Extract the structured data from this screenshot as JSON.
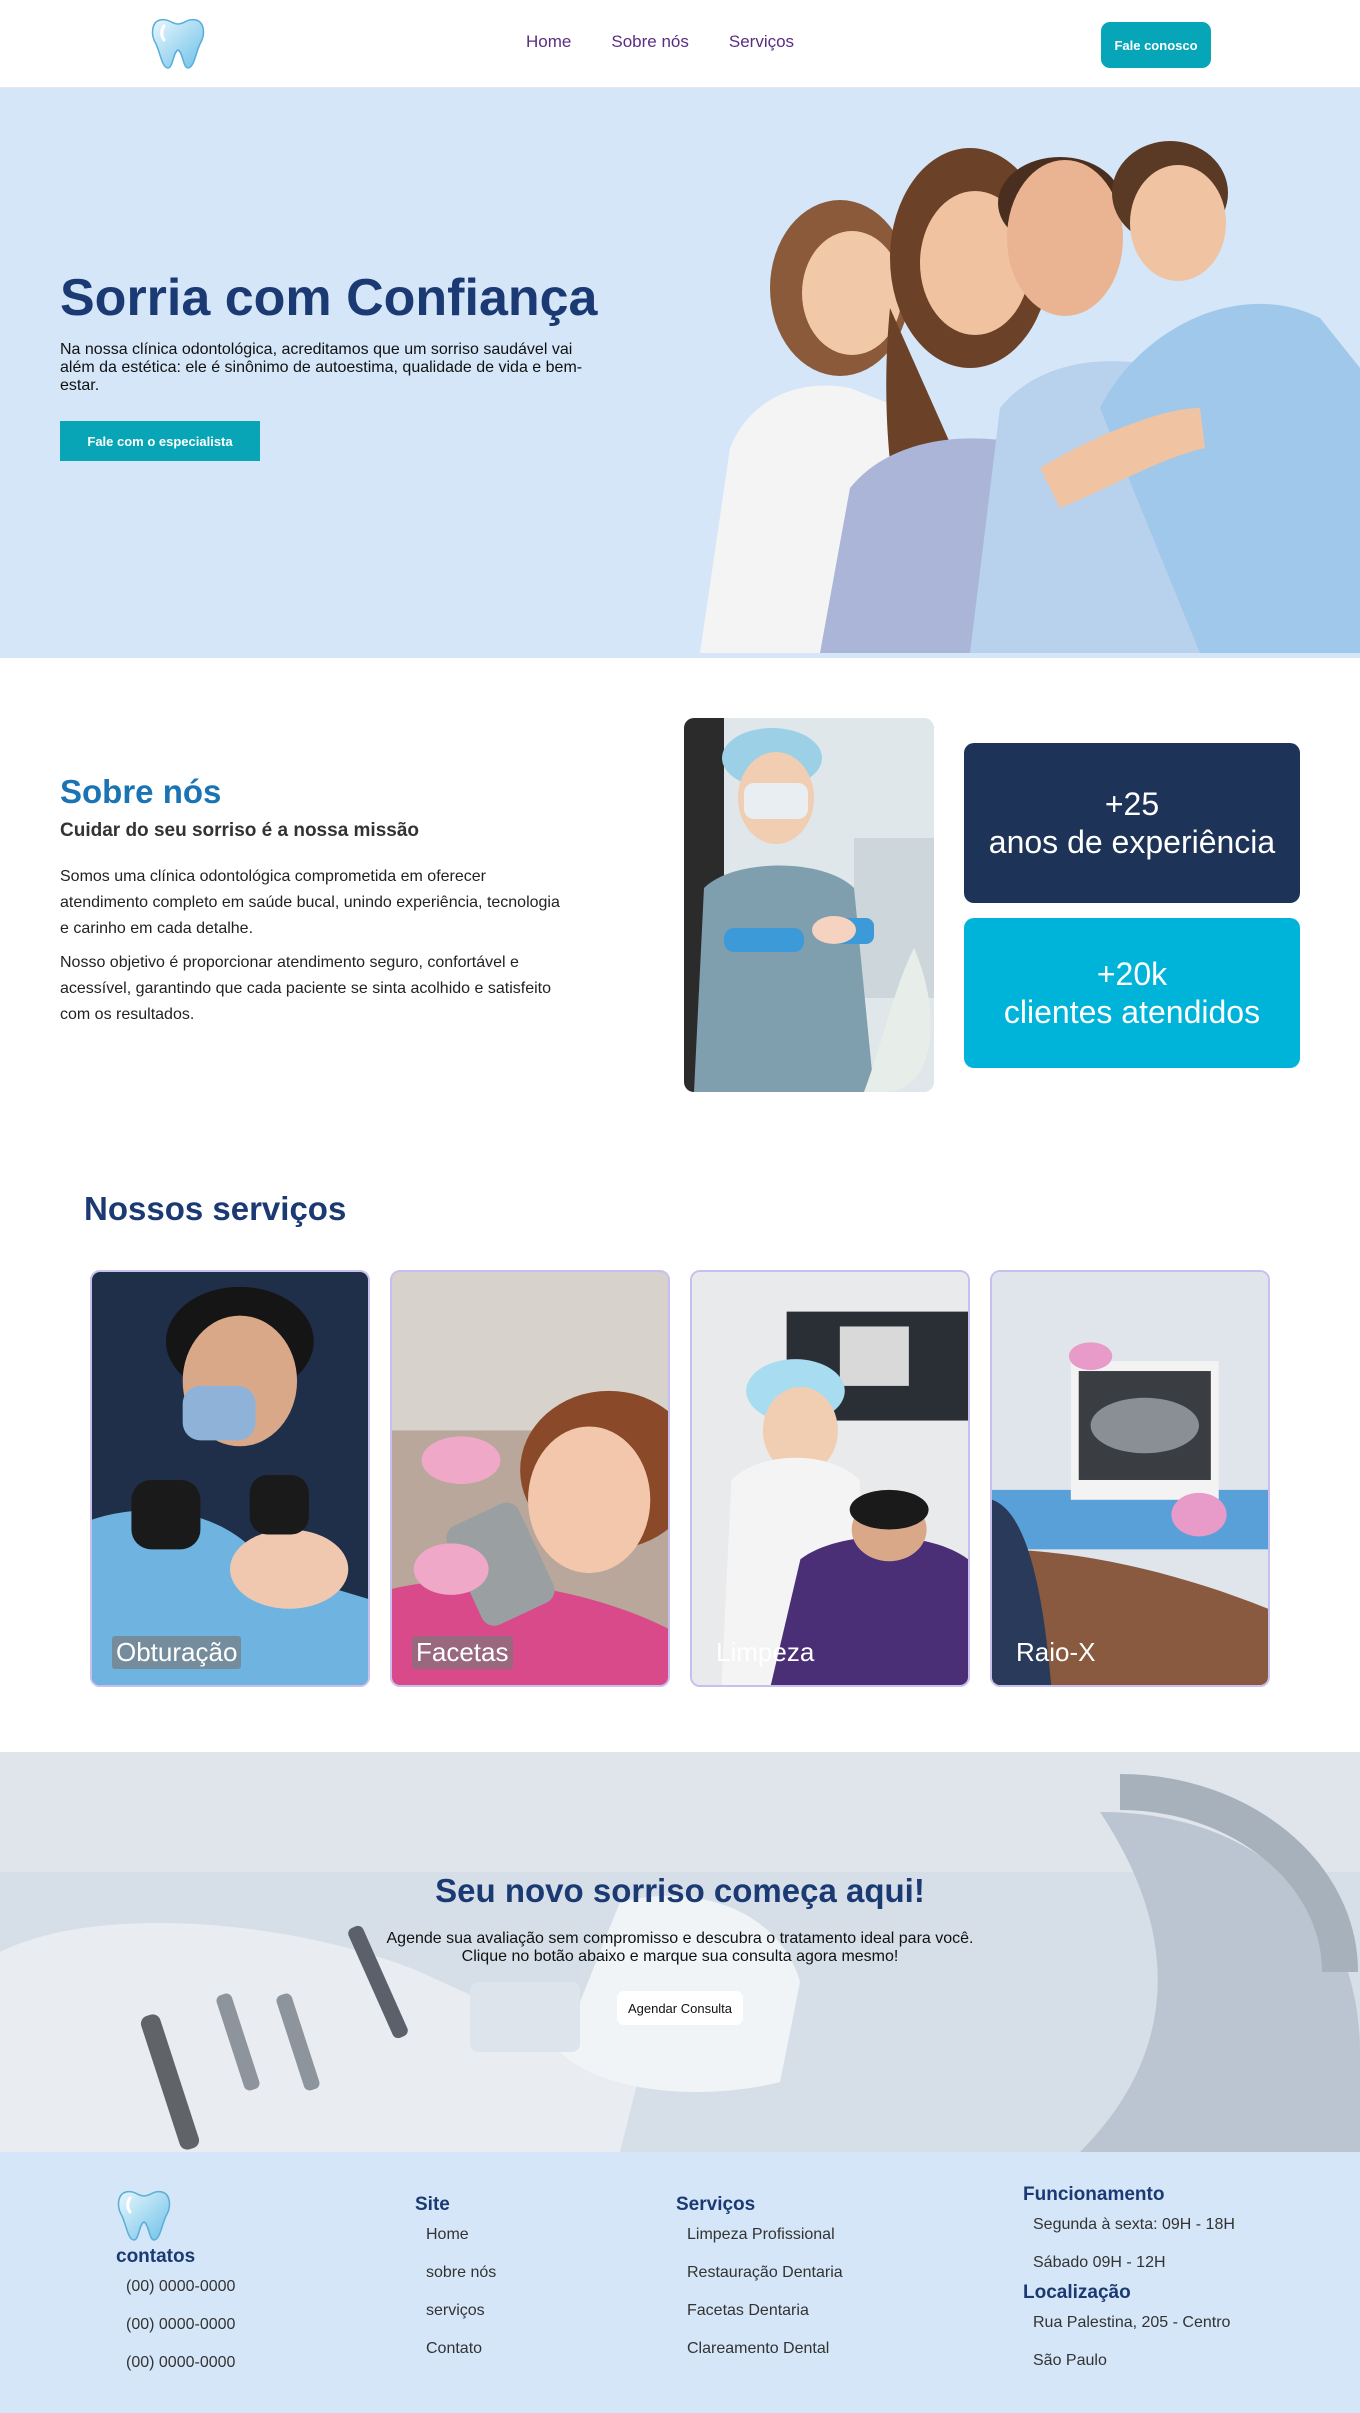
{
  "header": {
    "logo_icon": "tooth-icon",
    "nav": [
      "Home",
      "Sobre nós",
      "Serviços"
    ],
    "cta_label": "Fale conosco"
  },
  "hero": {
    "title": "Sorria com Confiança",
    "text": "Na nossa clínica odontológica, acreditamos que um sorriso saudável vai além da estética: ele é sinônimo de autoestima, qualidade de vida e bem-estar.",
    "button": "Fale com o especialista"
  },
  "about": {
    "title": "Sobre nós",
    "subtitle": "Cuidar do seu sorriso é a nossa missão",
    "p1": "Somos uma clínica odontológica comprometida em oferecer atendimento completo em saúde bucal, unindo experiência, tecnologia e carinho em cada detalhe.",
    "p2": "Nosso objetivo é proporcionar atendimento seguro, confortável e acessível, garantindo que cada paciente se sinta acolhido e satisfeito com os resultados.",
    "stats": [
      {
        "value": "+25",
        "label": "anos de experiência"
      },
      {
        "value": "+20k",
        "label": "clientes atendidos"
      }
    ]
  },
  "services": {
    "title": "Nossos serviços",
    "cards": [
      "Obturação",
      "Facetas",
      "Limpeza",
      "Raio-X"
    ]
  },
  "cta": {
    "title": "Seu novo sorriso começa aqui!",
    "line1": "Agende sua avaliação sem compromisso e descubra o tratamento ideal para você.",
    "line2": "Clique no botão abaixo e marque sua consulta agora mesmo!",
    "button": "Agendar Consulta"
  },
  "footer": {
    "contacts_title": "contatos",
    "phones": [
      "(00) 0000-0000",
      "(00) 0000-0000",
      "(00) 0000-0000"
    ],
    "site_title": "Site",
    "site_links": [
      "Home",
      "sobre nós",
      "serviços",
      "Contato"
    ],
    "services_title": "Serviços",
    "service_links": [
      "Limpeza Profissional",
      "Restauração Dentaria",
      "Facetas Dentaria",
      "Clareamento Dental"
    ],
    "hours_title": "Funcionamento",
    "hours": [
      "Segunda à sexta: 09H - 18H",
      "Sábado 09H - 12H"
    ],
    "location_title": "Localização",
    "location": [
      "Rua Palestina, 205 - Centro",
      "São Paulo"
    ]
  },
  "colors": {
    "brand_blue": "#1b3a73",
    "accent_teal": "#06a6b8",
    "hero_bg": "#d4e6f7",
    "stat_dark": "#1e3358",
    "stat_cyan": "#00b4d9"
  }
}
